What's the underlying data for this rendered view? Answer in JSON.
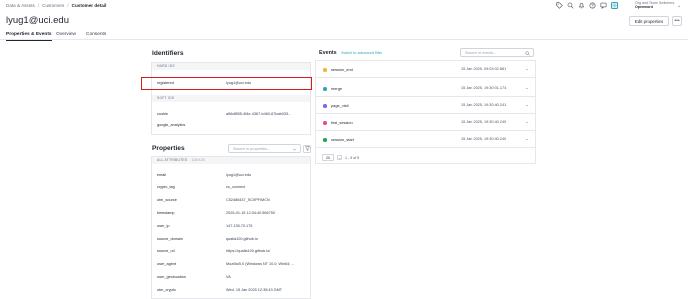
{
  "breadcrumb": [
    "Data & Assets",
    "Customers",
    "Customer detail"
  ],
  "org": {
    "sub": "Org and Team Switchers",
    "name": "Openword"
  },
  "page_title": "lyug1@uci.edu",
  "edit_label": "Edit properties",
  "more_label": "•••",
  "tabs": [
    {
      "label": "Properties & Events",
      "active": true
    },
    {
      "label": "Overview",
      "active": false
    },
    {
      "label": "Consents",
      "active": false
    }
  ],
  "identifiers": {
    "title": "Identifiers",
    "hard_header": "HARD IDS",
    "hard": [
      {
        "key": "registered",
        "value": "lyug1@uci.edu"
      }
    ],
    "soft_header": "SOFT IDS",
    "soft": [
      {
        "key": "cookie",
        "value": "a56df855-4f4e-4367-b463-67bab033..."
      },
      {
        "key": "google_analytics",
        "value": ""
      }
    ]
  },
  "properties": {
    "title": "Properties",
    "search_placeholder": "Search in properties...",
    "header": "ALL ATTRIBUTES",
    "header_count": "115/425",
    "rows": [
      {
        "key": "email",
        "value": "lyug1@uci.edu"
      },
      {
        "key": "crypto_tag",
        "value": "cs_connect"
      },
      {
        "key": "utm_source",
        "value": "C52486437_SCIIPFIMCN"
      },
      {
        "key": "timestamp",
        "value": "2025-01-15 12:34:40.566750"
      },
      {
        "key": "user_ip",
        "value": "147.135.70.175"
      },
      {
        "key": "source_domain",
        "value": "qualia100.github.io"
      },
      {
        "key": "source_url",
        "value": "https://qualia100.github.io/"
      },
      {
        "key": "user_agent",
        "value": "Mozilla/5.0 (Windows NT 10.0; Win64; ..."
      },
      {
        "key": "user_geolocation",
        "value": "VA"
      },
      {
        "key": "utm_crypto",
        "value": "Wed, 15 Jan 2025 12:35:43 GMT"
      }
    ]
  },
  "events": {
    "title": "Events",
    "link": "Switch to advanced filter",
    "search_placeholder": "Search in events...",
    "rows": [
      {
        "name": "session_end",
        "time": "15 Jan 2025, 09:03:02.881",
        "color": "#f2b632"
      },
      {
        "name": "merge",
        "time": "15 Jan 2025, 19:30:01.174",
        "color": "#2fa5b5"
      },
      {
        "name": "page_visit",
        "time": "15 Jan 2025, 19:30:40.241",
        "color": "#8b5cf6"
      },
      {
        "name": "first_session",
        "time": "15 Jan 2025, 19:30:40.240",
        "color": "#ec4899"
      },
      {
        "name": "session_start",
        "time": "15 Jan 2025, 19:30:40.240",
        "color": "#22a35a"
      }
    ],
    "page_size": "20",
    "page_range": "1 - 5 of 5"
  },
  "colors": {
    "accent": "#2fa5b5",
    "highlight": "#d81b1b"
  },
  "icons": [
    "tag-icon",
    "search-icon",
    "bell-icon",
    "help-icon",
    "chat-icon",
    "settings-icon"
  ]
}
